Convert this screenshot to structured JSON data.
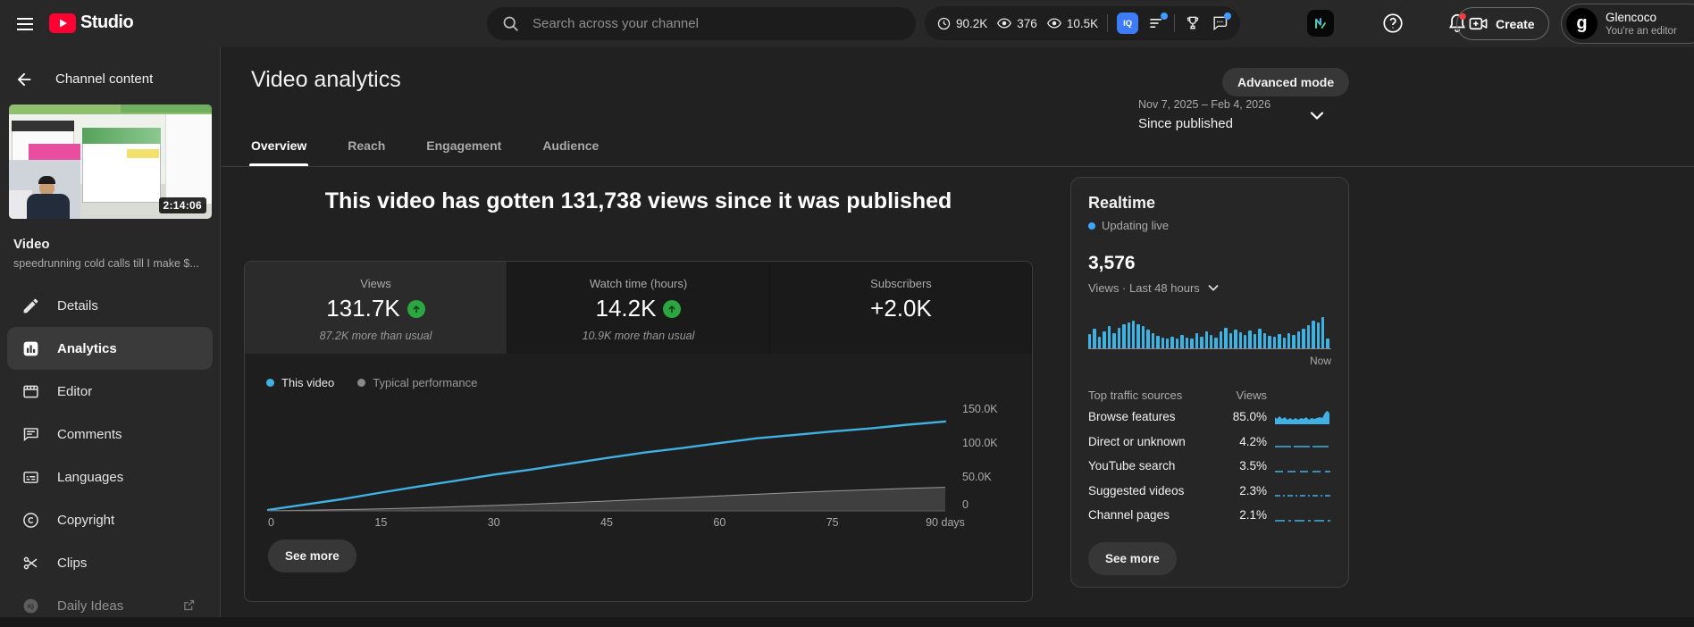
{
  "colors": {
    "accent_blue": "#3fb1e3",
    "green_up": "#2ba640",
    "brand_red": "#ff0033",
    "notification_red": "#ff3d3d",
    "live_blue": "#3ea6ff"
  },
  "topbar": {
    "brand_text": "Studio",
    "search_placeholder": "Search across your channel",
    "stats": [
      {
        "icon": "clock-icon",
        "value": "90.2K"
      },
      {
        "icon": "eye-icon",
        "value": "376"
      },
      {
        "icon": "eye-icon",
        "value": "10.5K"
      }
    ],
    "vidiq_label": "IQ",
    "create_label": "Create",
    "profile_name": "Glencoco",
    "profile_role": "You're an editor",
    "avatar_letter": "g"
  },
  "sidebar": {
    "back_title": "Channel content",
    "video_duration": "2:14:06",
    "video_type": "Video",
    "video_title": "speedrunning cold calls till I make $...",
    "items": [
      {
        "label": "Details"
      },
      {
        "label": "Analytics"
      },
      {
        "label": "Editor"
      },
      {
        "label": "Comments"
      },
      {
        "label": "Languages"
      },
      {
        "label": "Copyright"
      },
      {
        "label": "Clips"
      },
      {
        "label": "Daily Ideas"
      }
    ]
  },
  "main": {
    "page_title": "Video analytics",
    "advanced_mode_label": "Advanced mode",
    "tabs": [
      "Overview",
      "Reach",
      "Engagement",
      "Audience"
    ],
    "date_range": "Nov 7, 2025 – Feb 4, 2026",
    "date_mode": "Since published",
    "headline": "This video has gotten 131,738 views since it was published",
    "metrics": [
      {
        "label": "Views",
        "value": "131.7K",
        "trend": "up",
        "note": "87.2K more than usual"
      },
      {
        "label": "Watch time (hours)",
        "value": "14.2K",
        "trend": "up",
        "note": "10.9K more than usual"
      },
      {
        "label": "Subscribers",
        "value": "+2.0K"
      }
    ],
    "legend": [
      "This video",
      "Typical performance"
    ],
    "see_more_label": "See more"
  },
  "chart_data": {
    "type": "line",
    "title": "Cumulative views since published",
    "x": [
      0,
      5,
      10,
      15,
      20,
      25,
      30,
      35,
      40,
      45,
      50,
      55,
      60,
      65,
      70,
      75,
      80,
      85,
      90
    ],
    "series": [
      {
        "name": "This video",
        "color": "#3fb1e3",
        "fill": false,
        "values": [
          1500,
          9500,
          17500,
          27000,
          36000,
          44500,
          53500,
          61000,
          69500,
          78000,
          86000,
          92500,
          100000,
          107000,
          112000,
          117000,
          121500,
          127000,
          131738
        ]
      },
      {
        "name": "Typical performance",
        "color": "#9a9a9a",
        "fill": true,
        "fill_color": "#3f3f3f",
        "values": [
          300,
          900,
          1800,
          3000,
          4500,
          6200,
          8000,
          10000,
          12200,
          14500,
          17000,
          19500,
          22000,
          24500,
          27000,
          29300,
          31400,
          33200,
          34800
        ]
      }
    ],
    "x_ticks": [
      {
        "value": 0,
        "label": "0"
      },
      {
        "value": 15,
        "label": "15"
      },
      {
        "value": 30,
        "label": "30"
      },
      {
        "value": 45,
        "label": "45"
      },
      {
        "value": 60,
        "label": "60"
      },
      {
        "value": 75,
        "label": "75"
      },
      {
        "value": 90,
        "label": "90 days"
      }
    ],
    "y_ticks": [
      {
        "value": 150000,
        "label": "150.0K"
      },
      {
        "value": 100000,
        "label": "100.0K"
      },
      {
        "value": 50000,
        "label": "50.0K"
      },
      {
        "value": 0,
        "label": "0"
      }
    ],
    "xlim": [
      0,
      90
    ],
    "ylim": [
      0,
      158000
    ],
    "grid": false,
    "legend_position": "top-left"
  },
  "realtime": {
    "title": "Realtime",
    "status": "Updating live",
    "views": "3,576",
    "views_caption": "Views · Last 48 hours",
    "now_label": "Now",
    "bars": [
      16,
      22,
      13,
      19,
      25,
      17,
      23,
      27,
      29,
      31,
      27,
      25,
      21,
      17,
      14,
      12,
      11,
      13,
      11,
      15,
      12,
      11,
      17,
      13,
      19,
      15,
      12,
      19,
      23,
      17,
      21,
      18,
      15,
      20,
      16,
      22,
      17,
      14,
      13,
      16,
      12,
      17,
      15,
      19,
      22,
      26,
      31,
      29,
      35,
      11
    ],
    "traffic": {
      "header": [
        "Top traffic sources",
        "Views"
      ],
      "rows": [
        {
          "label": "Browse features",
          "value": "85.0%",
          "spark": "area"
        },
        {
          "label": "Direct or unknown",
          "value": "4.2%",
          "spark": "solid"
        },
        {
          "label": "YouTube search",
          "value": "3.5%",
          "spark": "dashed"
        },
        {
          "label": "Suggested videos",
          "value": "2.3%",
          "spark": "dash2"
        },
        {
          "label": "Channel pages",
          "value": "2.1%",
          "spark": "dashdot"
        }
      ]
    },
    "see_more_label": "See more"
  }
}
